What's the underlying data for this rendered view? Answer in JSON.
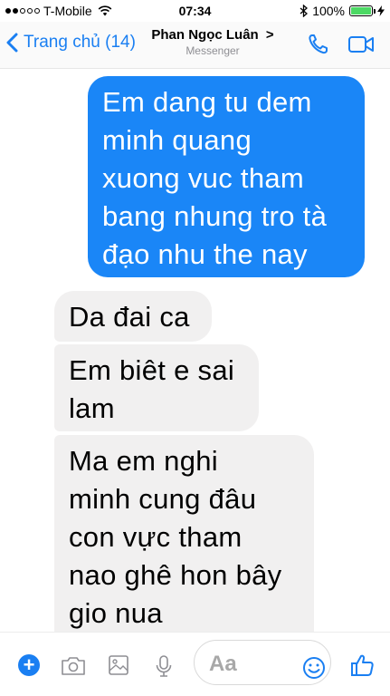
{
  "status_bar": {
    "carrier": "T-Mobile",
    "time": "07:34",
    "battery_percent": "100%",
    "battery_level": 1.0
  },
  "nav": {
    "back_label": "Trang chủ (14)",
    "contact_name": "Phan Ngọc Luân",
    "contact_chevron": ">",
    "subtitle": "Messenger",
    "icons": [
      "chevron-left-icon",
      "phone-icon",
      "video-camera-icon"
    ]
  },
  "messages": [
    {
      "side": "outgoing",
      "lines": [
        "Em dang tu dem",
        "minh quang",
        "xuong vuc tham",
        "bang nhung tro tà",
        "đạo nhu the nay"
      ]
    },
    {
      "side": "incoming",
      "lines": [
        "Da đai ca"
      ]
    },
    {
      "side": "incoming",
      "lines": [
        "Em biêt e sai",
        "lam"
      ]
    },
    {
      "side": "incoming",
      "lines": [
        "Ma em nghi",
        "minh cung đâu",
        "con vực tham",
        "nao ghê hon bây",
        "gio nua"
      ]
    }
  ],
  "composer": {
    "placeholder": "Aa",
    "icons": [
      "plus-icon",
      "camera-icon",
      "photo-icon",
      "microphone-icon",
      "emoji-icon",
      "thumbs-up-icon"
    ]
  },
  "colors": {
    "accent": "#1a7ff2",
    "outgoing_bubble": "#1a86f7",
    "incoming_bubble": "#f1f0f0",
    "battery": "#4cd964"
  }
}
